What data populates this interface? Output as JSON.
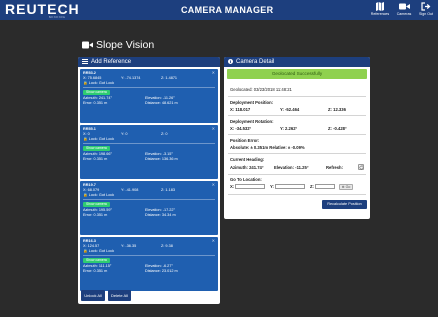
{
  "topbar": {
    "logo": "REUTECH",
    "logo_sub": "MINING",
    "title": "CAMERA MANAGER",
    "nav": [
      {
        "label": "References",
        "icon": "map-icon"
      },
      {
        "label": "Cameras",
        "icon": "video-camera-icon"
      },
      {
        "label": "Sign Out",
        "icon": "sign-out-icon"
      }
    ]
  },
  "page": {
    "heading": "Slope Vision"
  },
  "references": {
    "header": "Add Reference",
    "items": [
      {
        "name": "RR53.2",
        "x": "X: 75.6845",
        "y": "Y: -74.1374",
        "z": "Z: 1.4871",
        "lock": "Lock: Got Lock",
        "badge": "Show camera",
        "azimuth": "Azimuth: 241.74°",
        "elevation": "Elevation: -11.26°",
        "error": "Error: 0.351 m",
        "distance": "Distance: 48.621 m"
      },
      {
        "name": "RR55.1",
        "x": "X: 0",
        "y": "Y: 0",
        "z": "Z: 0",
        "lock": "Lock: Got Lock",
        "badge": "Show camera",
        "azimuth": "Azimuth: 198.66°",
        "elevation": "Elevation: -3.15°",
        "error": "Error: 0.351 m",
        "distance": "Distance: 136.36 m"
      },
      {
        "name": "RR19.7",
        "x": "X: 68.079",
        "y": "Y: -41.908",
        "z": "Z: 1.183",
        "lock": "Lock: Got Lock",
        "badge": "Show camera",
        "azimuth": "Azimuth: 195.59°",
        "elevation": "Elevation: -17.22°",
        "error": "Error: 0.351 m",
        "distance": "Distance: 34.34 m"
      },
      {
        "name": "RR16.3",
        "x": "X: 124.57",
        "y": "Y: -36.35",
        "z": "Z: 9.38",
        "lock": "Lock: Got Lock",
        "badge": "Show camera",
        "azimuth": "Azimuth: 111.15°",
        "elevation": "Elevation: -6.27°",
        "error": "Error: 0.351 m",
        "distance": "Distance: 23.012 m"
      }
    ],
    "unlock_all": "Unlock All",
    "delete_all": "Delete All"
  },
  "detail": {
    "header": "Camera Detail",
    "status": "Geolocated Successfully",
    "geolocated": "Geolocated: 03/23/2018 11:48:21",
    "deploy_pos_title": "Deployment Position:",
    "deploy_pos": {
      "x": "X: 118.017",
      "y": "Y: -52.464",
      "z": "Z: 12.336"
    },
    "deploy_rot_title": "Deployment Rotation:",
    "deploy_rot": {
      "x": "X: -34.532°",
      "y": "Y: 2.262°",
      "z": "Z: -0.428°"
    },
    "pos_error_title": "Position Error:",
    "pos_error": "Absolute: ± 0.351m   Relative: ± -0.09%",
    "heading_title": "Current Heading:",
    "heading": {
      "azimuth": "Azimuth: 241.74°",
      "elevation": "Elevation: -11.25°",
      "refresh": "Refresh:"
    },
    "goto_title": "Go To Location:",
    "goto": {
      "x": "X:",
      "y": "Y:",
      "z": "Z:",
      "go": "Go"
    },
    "recalc": "Recalculate Position"
  },
  "colors": {
    "primary": "#1d3f7e",
    "card": "#1f5fb0",
    "success": "#8fd14f",
    "badge": "#2ecc71",
    "background": "#2b2b2b"
  }
}
